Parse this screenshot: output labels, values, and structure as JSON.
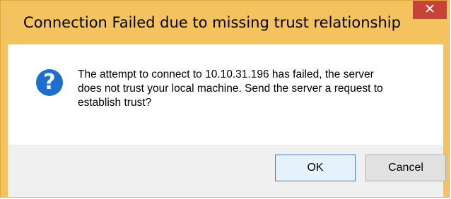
{
  "dialog": {
    "title": "Connection Failed due to missing trust relationship",
    "close_label": "✕",
    "icon": "question-icon",
    "icon_glyph": "?",
    "message_lines": [
      "The attempt to connect to 10.10.31.196 has failed, the server",
      "does not trust your local machine. Send the server a request to",
      "establish trust?"
    ],
    "buttons": {
      "ok": "OK",
      "cancel": "Cancel"
    }
  },
  "colors": {
    "frame": "#f4c360",
    "close_button": "#c7433a",
    "icon": "#1e6fcd",
    "ok_border": "#3c7fb1",
    "footer": "#f0f0f0"
  }
}
